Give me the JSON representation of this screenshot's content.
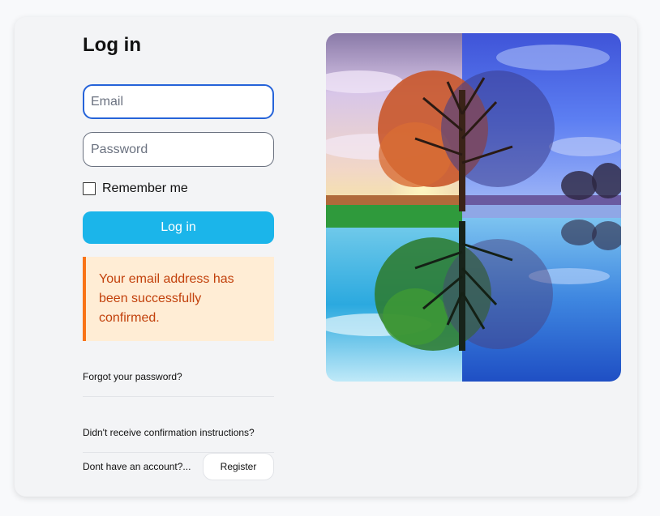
{
  "login": {
    "title": "Log in",
    "email_placeholder": "Email",
    "password_placeholder": "Password",
    "remember_label": "Remember me",
    "submit_label": "Log in"
  },
  "alert": {
    "message": "Your email address has been successfully confirmed."
  },
  "links": {
    "forgot_password": "Forgot your password?",
    "resend_confirmation": "Didn't receive confirmation instructions?",
    "no_account": "Dont have an account?...",
    "register": "Register"
  },
  "colors": {
    "primary": "#1bb5ea",
    "alert_bg": "#ffedd5",
    "alert_border": "#f97316",
    "alert_text": "#c2410c",
    "focus_border": "#2563d9"
  }
}
